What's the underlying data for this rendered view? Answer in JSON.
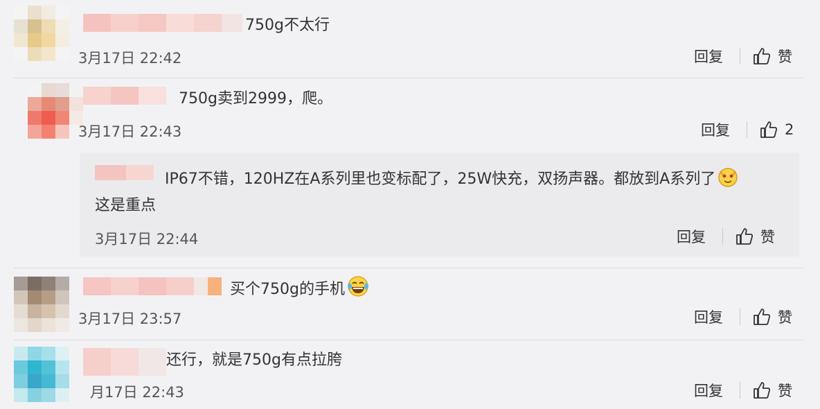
{
  "comments": [
    {
      "text": "750g不太行",
      "time": "3月17日 22:42",
      "reply_label": "回复",
      "like_label": "赞"
    },
    {
      "text": "750g卖到2999，爬。",
      "time": "3月17日 22:43",
      "reply_label": "回复",
      "like_count": "2",
      "nested_reply": {
        "text_line1": "IP67不错，120HZ在A系列里也变标配了，25W快充，双扬声器。都放到A系列了",
        "text_line2": "这是重点",
        "emoji": "doge-emoji",
        "time": "3月17日 22:44",
        "reply_label": "回复",
        "like_label": "赞"
      }
    },
    {
      "text": "买个750g的手机",
      "emoji": "laugh-tears-emoji",
      "time": "3月17日 23:57",
      "reply_label": "回复",
      "like_label": "赞"
    },
    {
      "text": "还行，就是750g有点拉胯",
      "time": "月17日 22:43",
      "reply_label": "回复",
      "like_label": "赞"
    }
  ],
  "colors": {
    "background": "#f2f2f5",
    "reply_background": "#ebebee",
    "text": "#333333"
  },
  "icons": {
    "like": "thumbs-up-icon"
  }
}
